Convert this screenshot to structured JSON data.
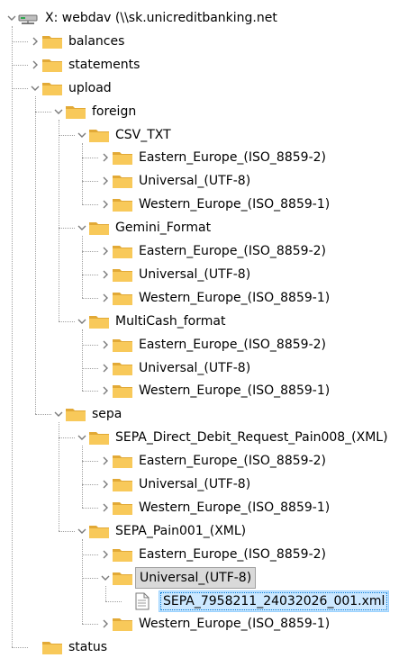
{
  "tree": {
    "rows": [
      {
        "label": "X: webdav (\\\\sk.unicreditbanking.net",
        "level": 0,
        "expanded": true,
        "icon": "network-drive-icon"
      },
      {
        "label": "balances",
        "level": 1,
        "expanded": false,
        "icon": "folder-icon"
      },
      {
        "label": "statements",
        "level": 1,
        "expanded": false,
        "icon": "folder-icon"
      },
      {
        "label": "upload",
        "level": 1,
        "expanded": true,
        "icon": "folder-icon"
      },
      {
        "label": "foreign",
        "level": 2,
        "expanded": true,
        "icon": "folder-icon"
      },
      {
        "label": "CSV_TXT",
        "level": 3,
        "expanded": true,
        "icon": "folder-icon"
      },
      {
        "label": "Eastern_Europe_(ISO_8859-2)",
        "level": 4,
        "expanded": false,
        "icon": "folder-icon"
      },
      {
        "label": "Universal_(UTF-8)",
        "level": 4,
        "expanded": false,
        "icon": "folder-icon"
      },
      {
        "label": "Western_Europe_(ISO_8859-1)",
        "level": 4,
        "expanded": false,
        "icon": "folder-icon"
      },
      {
        "label": "Gemini_Format",
        "level": 3,
        "expanded": true,
        "icon": "folder-icon"
      },
      {
        "label": "Eastern_Europe_(ISO_8859-2)",
        "level": 4,
        "expanded": false,
        "icon": "folder-icon"
      },
      {
        "label": "Universal_(UTF-8)",
        "level": 4,
        "expanded": false,
        "icon": "folder-icon"
      },
      {
        "label": "Western_Europe_(ISO_8859-1)",
        "level": 4,
        "expanded": false,
        "icon": "folder-icon"
      },
      {
        "label": "MultiCash_format",
        "level": 3,
        "expanded": true,
        "icon": "folder-icon"
      },
      {
        "label": "Eastern_Europe_(ISO_8859-2)",
        "level": 4,
        "expanded": false,
        "icon": "folder-icon"
      },
      {
        "label": "Universal_(UTF-8)",
        "level": 4,
        "expanded": false,
        "icon": "folder-icon"
      },
      {
        "label": "Western_Europe_(ISO_8859-1)",
        "level": 4,
        "expanded": false,
        "icon": "folder-icon"
      },
      {
        "label": "sepa",
        "level": 2,
        "expanded": true,
        "icon": "folder-icon"
      },
      {
        "label": "SEPA_Direct_Debit_Request_Pain008_(XML)",
        "level": 3,
        "expanded": true,
        "icon": "folder-icon"
      },
      {
        "label": "Eastern_Europe_(ISO_8859-2)",
        "level": 4,
        "expanded": false,
        "icon": "folder-icon"
      },
      {
        "label": "Universal_(UTF-8)",
        "level": 4,
        "expanded": false,
        "icon": "folder-icon"
      },
      {
        "label": "Western_Europe_(ISO_8859-1)",
        "level": 4,
        "expanded": false,
        "icon": "folder-icon"
      },
      {
        "label": "SEPA_Pain001_(XML)",
        "level": 3,
        "expanded": true,
        "icon": "folder-icon"
      },
      {
        "label": "Eastern_Europe_(ISO_8859-2)",
        "level": 4,
        "expanded": false,
        "icon": "folder-icon"
      },
      {
        "label": "Universal_(UTF-8)",
        "level": 4,
        "expanded": true,
        "icon": "folder-icon",
        "state": "selected"
      },
      {
        "label": "SEPA_7958211_24032026_001.xml",
        "level": 5,
        "icon": "xml-file-icon",
        "state": "focused"
      },
      {
        "label": "Western_Europe_(ISO_8859-1)",
        "level": 4,
        "expanded": false,
        "icon": "folder-icon"
      },
      {
        "label": "status",
        "level": 1,
        "icon": "folder-icon"
      }
    ]
  },
  "colors": {
    "folder": "#f8c95a",
    "folder_dark": "#e2a936",
    "selected_bg": "#d9d9d9",
    "focused_bg": "#cce8ff",
    "chevron": "#7a7a7a"
  }
}
